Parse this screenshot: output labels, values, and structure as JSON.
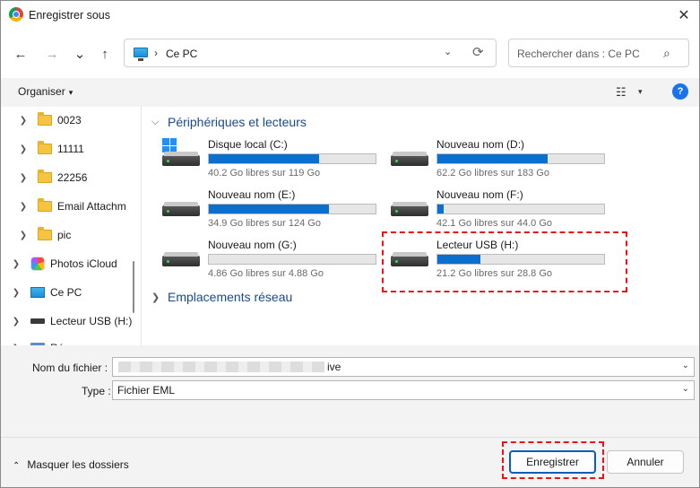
{
  "window": {
    "title": "Enregistrer sous",
    "close_label": "✕"
  },
  "nav": {
    "back": "←",
    "forward": "→",
    "recent": "⌄",
    "up": "↑",
    "address_sep": "›",
    "address": "Ce PC",
    "address_dd": "⌄",
    "refresh": "⟳",
    "search_placeholder": "Rechercher dans : Ce PC"
  },
  "toolbar": {
    "organize": "Organiser",
    "organize_caret": "▾",
    "view_icon": "☷",
    "view_caret": "▾",
    "help": "?"
  },
  "sidebar": {
    "items": [
      {
        "label": "0023",
        "icon": "folder-icon"
      },
      {
        "label": "11111",
        "icon": "folder-icon"
      },
      {
        "label": "22256",
        "icon": "folder-icon"
      },
      {
        "label": "Email Attachm",
        "icon": "folder-icon"
      },
      {
        "label": "pic",
        "icon": "folder-icon"
      },
      {
        "label": "Photos iCloud",
        "icon": "icloud-icon"
      },
      {
        "label": "Ce PC",
        "icon": "pc-icon"
      },
      {
        "label": "Lecteur USB (H:)",
        "icon": "usb-drive-icon"
      },
      {
        "label": "Ré",
        "icon": "network-icon"
      }
    ]
  },
  "main": {
    "group_devices": "Périphériques et lecteurs",
    "group_network": "Emplacements réseau",
    "drives": [
      {
        "name": "Disque local (C:)",
        "free": "40.2 Go libres sur 119 Go",
        "used_fraction": 0.66
      },
      {
        "name": "Nouveau nom (D:)",
        "free": "62.2 Go libres sur 183 Go",
        "used_fraction": 0.66
      },
      {
        "name": "Nouveau nom (E:)",
        "free": "34.9 Go libres sur 124 Go",
        "used_fraction": 0.72
      },
      {
        "name": "Nouveau nom (F:)",
        "free": "42.1 Go libres sur 44.0 Go",
        "used_fraction": 0.04
      },
      {
        "name": "Nouveau nom (G:)",
        "free": "4.86 Go libres sur 4.88 Go",
        "used_fraction": 0.0
      },
      {
        "name": "Lecteur USB (H:)",
        "free": "21.2 Go libres sur 28.8 Go",
        "used_fraction": 0.26
      }
    ]
  },
  "form": {
    "filename_label": "Nom du fichier :",
    "filename_value": "ive",
    "type_label": "Type :",
    "type_value": "Fichier EML",
    "dd": "⌄"
  },
  "footer": {
    "hide_folders": "Masquer les dossiers",
    "hide_caret": "⌃",
    "save": "Enregistrer",
    "cancel": "Annuler"
  },
  "colors": {
    "accent": "#0a6fcf",
    "highlight": "#e8141a",
    "link": "#1a4a8c"
  }
}
